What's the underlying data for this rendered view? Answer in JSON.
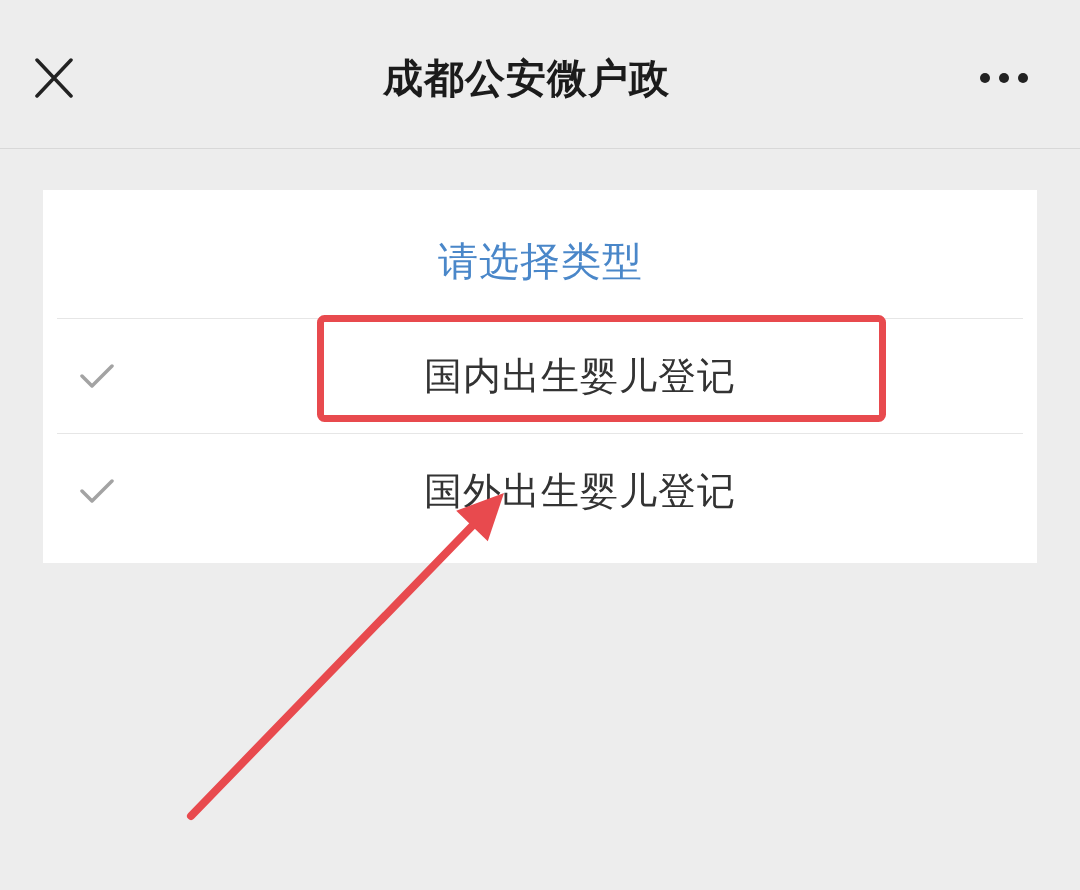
{
  "header": {
    "title": "成都公安微户政"
  },
  "sheet": {
    "title": "请选择类型",
    "options": [
      {
        "label": "国内出生婴儿登记",
        "selected": false,
        "highlighted": true,
        "pointed_at": false
      },
      {
        "label": "国外出生婴儿登记",
        "selected": false,
        "highlighted": false,
        "pointed_at": true
      }
    ]
  }
}
